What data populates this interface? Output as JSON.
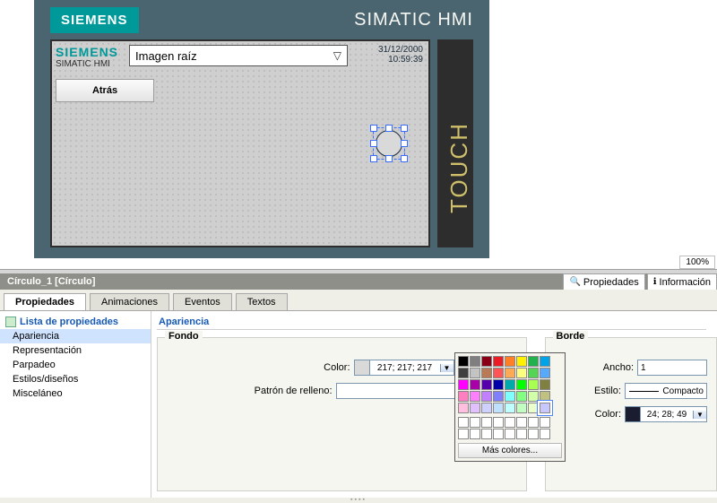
{
  "preview": {
    "brand": "SIEMENS",
    "device_title": "SIMATIC HMI",
    "screen_brand": "SIEMENS",
    "screen_sub": "SIMATIC HMI",
    "root_screen_label": "Imagen raíz",
    "date": "31/12/2000",
    "time": "10:59:39",
    "back_button": "Atrás",
    "touch_label": "TOUCH",
    "zoom": "100%"
  },
  "inspector": {
    "object_title": "Círculo_1 [Círculo]",
    "right_tabs": {
      "properties": "Propiedades",
      "info": "Información"
    },
    "main_tabs": [
      "Propiedades",
      "Animaciones",
      "Eventos",
      "Textos"
    ],
    "tree_header": "Lista de propiedades",
    "tree_items": [
      "Apariencia",
      "Representación",
      "Parpadeo",
      "Estilos/diseños",
      "Misceláneo"
    ],
    "section_title": "Apariencia",
    "fondo": {
      "group_title": "Fondo",
      "color_label": "Color:",
      "color_value": "217; 217; 217",
      "color_hex": "#d9d9d9",
      "pattern_label": "Patrón de relleno:"
    },
    "borde": {
      "group_title": "Borde",
      "width_label": "Ancho:",
      "width_value": "1",
      "style_label": "Estilo:",
      "style_value": "Compacto",
      "color_label": "Color:",
      "color_value": "24; 28; 49",
      "color_hex": "#181c31"
    },
    "picker": {
      "more": "Más colores...",
      "colors": [
        "#000000",
        "#7f7f7f",
        "#880015",
        "#ed1c24",
        "#ff7f27",
        "#fff200",
        "#22b14c",
        "#00a2e8",
        "#3f3f3f",
        "#c3c3c3",
        "#b97a57",
        "#ff5555",
        "#ffaa55",
        "#ffff80",
        "#55d455",
        "#55aaff",
        "#ff00ff",
        "#aa00aa",
        "#5500aa",
        "#0000aa",
        "#00aaaa",
        "#00ff00",
        "#aaff55",
        "#808040",
        "#ff80c0",
        "#ff80ff",
        "#c080ff",
        "#8080ff",
        "#80ffff",
        "#80ff80",
        "#d4ffaa",
        "#c0c080",
        "#ffc0e0",
        "#e0c0ff",
        "#d0d0ff",
        "#c0e0ff",
        "#c0ffff",
        "#c0ffc0",
        "#eaffcc",
        "#c8c8ff"
      ],
      "selected_index": 39
    }
  }
}
